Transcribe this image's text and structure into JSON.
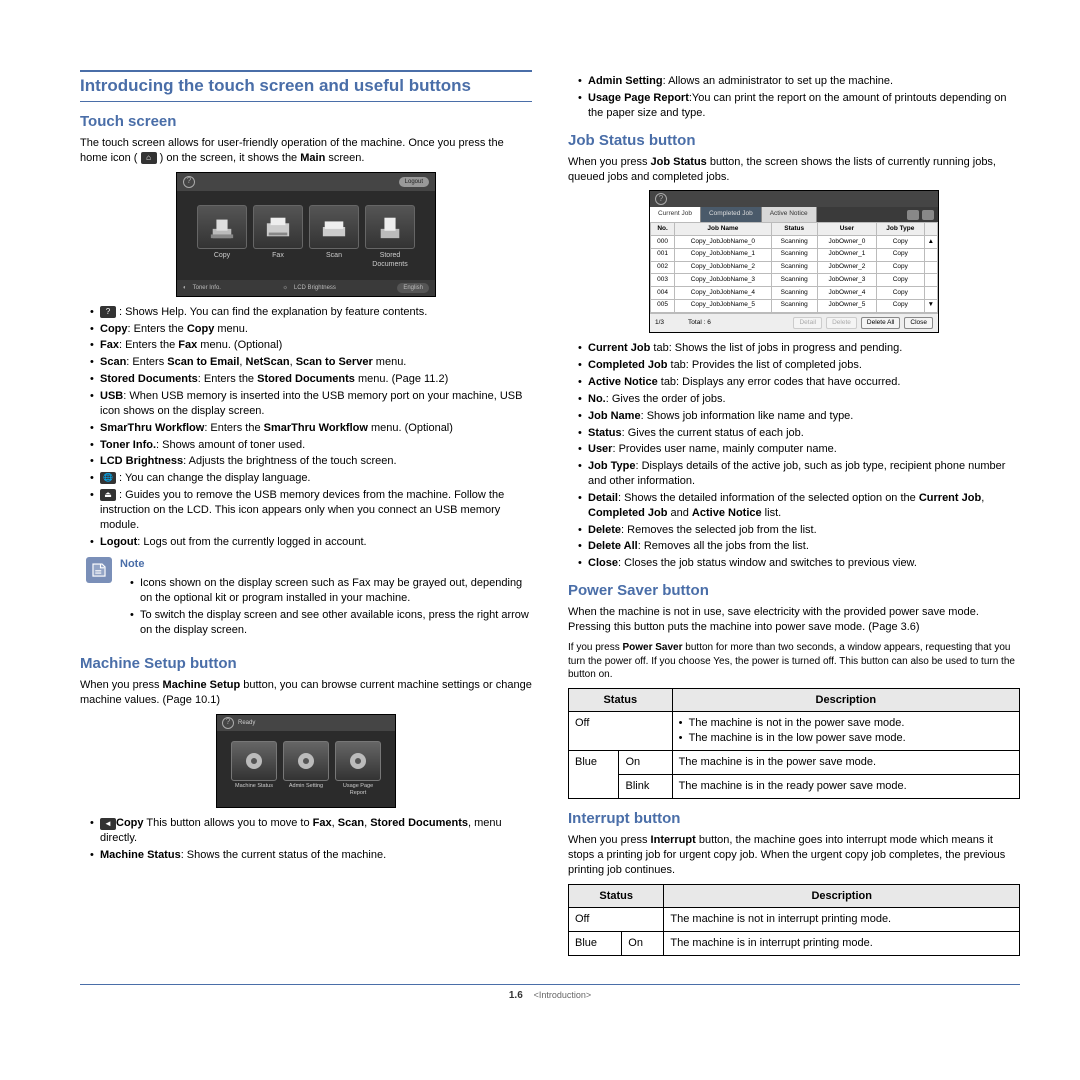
{
  "page": {
    "number": "1.6",
    "chapter": "<Introduction>"
  },
  "main_heading": "Introducing the touch screen and useful buttons",
  "touch": {
    "heading": "Touch screen",
    "intro_a": "The touch screen allows for user-friendly operation of the machine. Once you press the home icon (",
    "intro_b": ") on the screen, it shows the ",
    "intro_bold": "Main",
    "intro_c": " screen.",
    "tiles": [
      "Copy",
      "Fax",
      "Scan",
      "Stored Documents"
    ],
    "bottom_labels": [
      "Toner Info.",
      "LCD Brightness",
      "English"
    ],
    "logout_label": "Logout",
    "bullets": [
      {
        "icon": "help",
        "t": " : Shows Help. You can find the explanation by feature contents."
      },
      {
        "b": "Copy",
        "t": ": Enters the ",
        "b2": "Copy",
        "t2": " menu."
      },
      {
        "b": "Fax",
        "t": ": Enters the ",
        "b2": "Fax",
        "t2": " menu. (Optional)"
      },
      {
        "b": "Scan",
        "t": ": Enters ",
        "b2": "Scan to Email",
        "t2": ", ",
        "b3": "NetScan",
        "t3": ", ",
        "b4": "Scan to Server",
        "t4": " menu."
      },
      {
        "b": "Stored Documents",
        "t": ": Enters the ",
        "b2": "Stored Documents",
        "t2": " menu. (Page 11.2)"
      },
      {
        "b": "USB",
        "t": ": When USB memory is inserted into the USB memory port on your machine, USB icon shows on the display screen."
      },
      {
        "b": "SmarThru Workflow",
        "t": ": Enters the ",
        "b2": "SmarThru Workflow",
        "t2": " menu. (Optional)"
      },
      {
        "b": "Toner Info.",
        "t": ": Shows amount of toner used."
      },
      {
        "b": "LCD Brightness",
        "t": ": Adjusts the brightness of the touch screen."
      },
      {
        "icon": "globe",
        "t": " : You can change the display language."
      },
      {
        "icon": "eject",
        "t": " : Guides you to remove the USB memory devices from the machine. Follow the instruction on the LCD. This icon appears only when you connect an USB memory module."
      },
      {
        "b": "Logout",
        "t": ": Logs out from the currently logged in account."
      }
    ],
    "note_label": "Note",
    "note_items": [
      "Icons shown on the display screen such as Fax may be grayed out, depending on the optional kit or program installed in your machine.",
      "To switch the display screen and see other available icons, press the right arrow on the display screen."
    ]
  },
  "msetup": {
    "heading": "Machine Setup button",
    "intro_a": "When you press ",
    "intro_b": "Machine Setup",
    "intro_c": " button, you can browse current machine settings or change machine values. (Page 10.1)",
    "tiles": [
      "Machine Status",
      "Admin Setting",
      "Usage Page Report"
    ],
    "bullets": [
      {
        "icon": "back",
        "t": " This button allows you to move to ",
        "b": "Copy",
        "t2": ", ",
        "b2": "Fax",
        "t3": ", ",
        "b3": "Scan",
        "t4": ", ",
        "b4": "Stored Documents",
        "t5": " menu directly."
      },
      {
        "b": "Machine Status",
        "t": ": Shows the current status of the machine."
      }
    ]
  },
  "right_top": [
    {
      "b": "Admin Setting",
      "t": ": Allows an administrator to set up the machine."
    },
    {
      "b": "Usage Page Report",
      "t": ":You can print the report on the amount of printouts depending on the paper size and type."
    }
  ],
  "jobstatus": {
    "heading": "Job Status button",
    "intro_a": "When you press ",
    "intro_b": "Job Status",
    "intro_c": " button, the screen shows the lists of currently running jobs, queued jobs and completed jobs.",
    "tabs": [
      "Current Job",
      "Completed Job",
      "Active Notice"
    ],
    "headers": [
      "No.",
      "Job Name",
      "Status",
      "User",
      "Job Type"
    ],
    "rows": [
      [
        "000",
        "Copy_JobJobName_0",
        "Scanning",
        "JobOwner_0",
        "Copy"
      ],
      [
        "001",
        "Copy_JobJobName_1",
        "Scanning",
        "JobOwner_1",
        "Copy"
      ],
      [
        "002",
        "Copy_JobJobName_2",
        "Scanning",
        "JobOwner_2",
        "Copy"
      ],
      [
        "003",
        "Copy_JobJobName_3",
        "Scanning",
        "JobOwner_3",
        "Copy"
      ],
      [
        "004",
        "Copy_JobJobName_4",
        "Scanning",
        "JobOwner_4",
        "Copy"
      ],
      [
        "005",
        "Copy_JobJobName_5",
        "Scanning",
        "JobOwner_5",
        "Copy"
      ]
    ],
    "footer": {
      "page": "1/3",
      "total": "Total : 6",
      "buttons": [
        "Detail",
        "Delete",
        "Delete All",
        "Close"
      ]
    },
    "bullets": [
      {
        "b": "Current Job",
        "t": " tab: Shows the list of jobs in progress and pending."
      },
      {
        "b": "Completed Job",
        "t": " tab: Provides the list of completed jobs."
      },
      {
        "b": "Active Notice",
        "t": " tab: Displays any error codes that have occurred."
      },
      {
        "b": "No.",
        "t": ": Gives the order of jobs."
      },
      {
        "b": "Job Name",
        "t": ": Shows job information like name and type."
      },
      {
        "b": "Status",
        "t": ": Gives the current status of each job."
      },
      {
        "b": "User",
        "t": ": Provides user name, mainly computer name."
      },
      {
        "b": "Job Type",
        "t": ": Displays details of the active job, such as job type, recipient phone number and other information."
      },
      {
        "b": "Detail",
        "t": ": Shows the detailed information of the selected option on the ",
        "b2": "Current Job",
        "t2": ", ",
        "b3": "Completed Job",
        "t3": " and ",
        "b4": "Active Notice",
        "t4": " list."
      },
      {
        "b": "Delete",
        "t": ": Removes the selected job from the list."
      },
      {
        "b": "Delete All",
        "t": ": Removes all the jobs from the list."
      },
      {
        "b": "Close",
        "t": ": Closes the job status window and switches to previous view."
      }
    ]
  },
  "powersaver": {
    "heading": "Power Saver button",
    "p1": "When the machine is not in use, save electricity with the provided power save mode. Pressing this button puts the machine into power save mode. (Page 3.6)",
    "p2_a": "If you press ",
    "p2_b": "Power Saver",
    "p2_c": " button for more than two seconds, a window appears, requesting that you turn the power off. If you choose Yes, the power is turned off. This button can also be used to turn the button on.",
    "table": {
      "head": [
        "Status",
        "Description"
      ],
      "rows": [
        {
          "s1": "Off",
          "s2": "",
          "d": [
            "The machine is not in the power save mode.",
            "The machine is in the low power save mode."
          ]
        },
        {
          "s1": "Blue",
          "s2": "On",
          "d": "The machine is in the power save mode."
        },
        {
          "s1": "",
          "s2": "Blink",
          "d": "The machine is in the ready power save mode."
        }
      ]
    }
  },
  "interrupt": {
    "heading": "Interrupt button",
    "p_a": "When you press ",
    "p_b": "Interrupt",
    "p_c": " button, the machine goes into interrupt mode which means it stops a printing job for urgent copy job. When the urgent copy job completes, the previous printing job continues.",
    "table": {
      "head": [
        "Status",
        "Description"
      ],
      "rows": [
        {
          "s1": "Off",
          "s2": "",
          "d": "The machine is not in interrupt printing mode."
        },
        {
          "s1": "Blue",
          "s2": "On",
          "d": "The machine is in interrupt printing mode."
        }
      ]
    }
  }
}
